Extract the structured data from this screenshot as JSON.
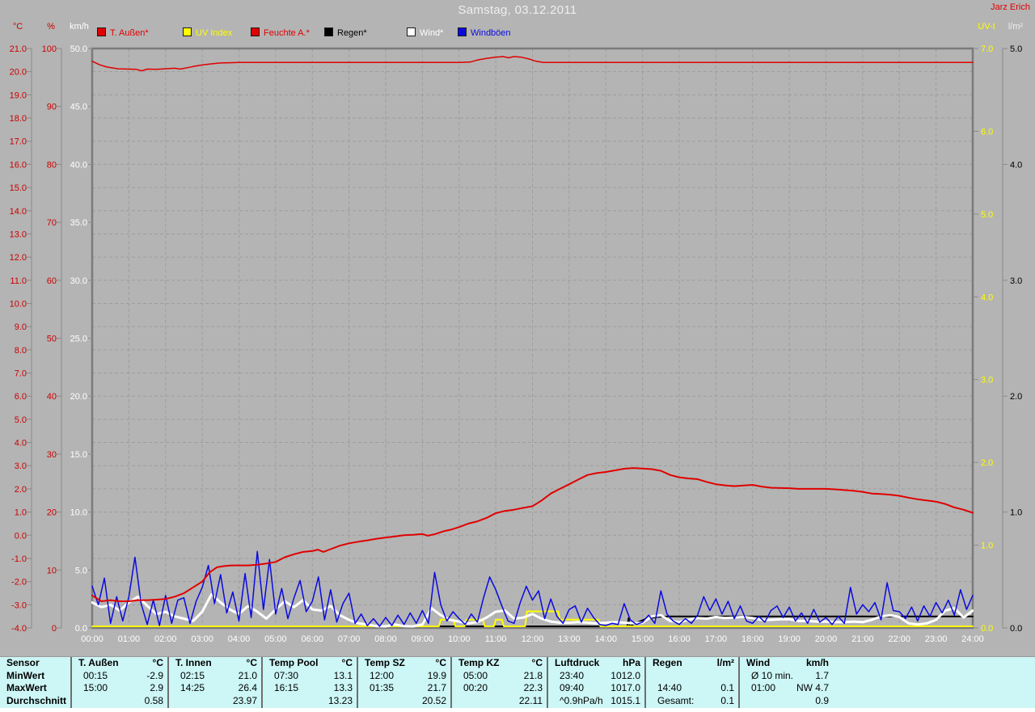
{
  "window": {
    "title": "Samstag, 03.12.2011",
    "credit": "Jarz Erich"
  },
  "legend": [
    {
      "label": "T. Außen*",
      "color": "#e00000"
    },
    {
      "label": "UV Index",
      "color": "#ffff00"
    },
    {
      "label": "Feuchte A.*",
      "color": "#e00000"
    },
    {
      "label": "Regen*",
      "color": "#000000"
    },
    {
      "label": "Wind*",
      "color": "#ffffff"
    },
    {
      "label": "Windböen",
      "color": "#0a0ae0"
    }
  ],
  "axes": {
    "left": [
      {
        "name": "°C",
        "color": "#cc0000",
        "min": -4,
        "max": 21,
        "step": 1,
        "decimals": 1
      },
      {
        "name": "%",
        "color": "#cc0000",
        "min": 0,
        "max": 100,
        "step": 10,
        "decimals": 0
      },
      {
        "name": "km/h",
        "color": "#ffffff",
        "min": 0,
        "max": 50,
        "step": 5,
        "decimals": 1
      }
    ],
    "right": [
      {
        "name": "UV-I",
        "color": "#ffff00",
        "min": 0,
        "max": 7,
        "step": 1,
        "decimals": 1
      },
      {
        "name": "l/m²",
        "color": "#000000",
        "header_color": "#eeeeee",
        "min": 0,
        "max": 5,
        "step": 1,
        "decimals": 1
      }
    ],
    "x_labels": [
      "00:00",
      "01:00",
      "02:00",
      "03:00",
      "04:00",
      "05:00",
      "06:00",
      "07:00",
      "08:00",
      "09:00",
      "10:00",
      "11:00",
      "12:00",
      "13:00",
      "14:00",
      "15:00",
      "16:00",
      "17:00",
      "18:00",
      "19:00",
      "20:00",
      "21:00",
      "22:00",
      "23:00",
      "24:00"
    ]
  },
  "chart_data": {
    "type": "line",
    "title": "Samstag, 03.12.2011",
    "x_unit": "hour",
    "x_range": [
      0,
      24
    ],
    "grid": "on",
    "series": [
      {
        "key": "regen",
        "name": "Regen",
        "axis": "l/m²",
        "unit": "l/m²",
        "color": "#000000",
        "width": 2,
        "points": [
          [
            0,
            0
          ],
          [
            14.58,
            0
          ],
          [
            14.62,
            0.085
          ],
          [
            14.65,
            0.01
          ],
          [
            14.8,
            0.04
          ],
          [
            15.1,
            0.08
          ],
          [
            15.4,
            0.095
          ],
          [
            15.7,
            0.1
          ],
          [
            24,
            0.1
          ]
        ]
      },
      {
        "key": "uv",
        "name": "UV Index",
        "axis": "UV-I",
        "unit": "UV-I",
        "color": "#ffff00",
        "width": 2,
        "points": [
          [
            0,
            0
          ],
          [
            9.45,
            0
          ],
          [
            9.5,
            0.1
          ],
          [
            9.85,
            0.1
          ],
          [
            9.9,
            0
          ],
          [
            10.15,
            0
          ],
          [
            10.2,
            0.1
          ],
          [
            10.65,
            0.1
          ],
          [
            10.7,
            0
          ],
          [
            10.95,
            0
          ],
          [
            11.0,
            0.1
          ],
          [
            11.17,
            0.1
          ],
          [
            11.22,
            0
          ],
          [
            11.8,
            0
          ],
          [
            11.85,
            0.2
          ],
          [
            12.7,
            0.2
          ],
          [
            12.75,
            0.1
          ],
          [
            13.8,
            0.1
          ],
          [
            13.85,
            0
          ],
          [
            24,
            0
          ]
        ]
      },
      {
        "key": "wind",
        "name": "Wind",
        "axis": "km/h",
        "unit": "km/h",
        "color": "#ffffff",
        "width": 3,
        "start": 0,
        "step_min": 15,
        "values": [
          2.2,
          1.8,
          2.0,
          1.5,
          2.2,
          2.7,
          1.9,
          1.2,
          1.4,
          1.0,
          0.8,
          0.6,
          1.4,
          2.9,
          2.2,
          1.6,
          1.2,
          1.9,
          1.4,
          0.8,
          1.6,
          2.3,
          1.8,
          2.4,
          1.6,
          1.5,
          1.9,
          1.1,
          0.7,
          0.4,
          0.3,
          0.15,
          0.1,
          0.3,
          0.15,
          0.1,
          0.3,
          1.7,
          1.1,
          0.7,
          0.55,
          0.4,
          0.5,
          0.9,
          1.4,
          1.5,
          0.8,
          0.9,
          1.2,
          0.8,
          0.55,
          0.45,
          0.45,
          0.5,
          0.45,
          0.4,
          0.45,
          0.5,
          0.45,
          0.4,
          0.45,
          1.0,
          1.1,
          0.6,
          0.5,
          0.7,
          0.85,
          0.8,
          0.95,
          0.85,
          0.9,
          0.95,
          0.85,
          0.7,
          0.7,
          0.75,
          0.75,
          0.6,
          0.6,
          0.55,
          0.55,
          0.5,
          0.5,
          0.55,
          0.5,
          0.7,
          1.0,
          1.1,
          0.95,
          0.4,
          0.3,
          0.4,
          0.7,
          1.5,
          1.7,
          0.9,
          1.5
        ]
      },
      {
        "key": "windboeen",
        "name": "Windböen",
        "axis": "km/h",
        "unit": "km/h",
        "color": "#0a0ae0",
        "width": 1.5,
        "start": 0,
        "step_min": 10,
        "values": [
          3.6,
          2.0,
          4.3,
          0.4,
          2.7,
          0.6,
          2.7,
          6.1,
          2.1,
          0.3,
          2.4,
          0.2,
          2.8,
          0.4,
          2.4,
          2.6,
          0.4,
          2.3,
          3.5,
          5.4,
          2.1,
          4.6,
          1.3,
          3.1,
          0.6,
          4.7,
          0.9,
          6.6,
          1.6,
          5.9,
          1.2,
          3.4,
          0.8,
          2.6,
          4.1,
          1.4,
          2.3,
          4.4,
          0.7,
          3.3,
          0.5,
          2.1,
          3.0,
          0.4,
          1.2,
          0.2,
          0.8,
          0.1,
          0.9,
          0.2,
          1.1,
          0.3,
          1.3,
          0.4,
          1.5,
          0.4,
          4.8,
          2.0,
          0.6,
          1.4,
          0.8,
          0.3,
          1.2,
          0.5,
          2.6,
          4.4,
          3.3,
          1.9,
          0.6,
          0.4,
          2.2,
          3.6,
          2.4,
          3.2,
          0.8,
          2.5,
          1.0,
          0.4,
          1.6,
          1.9,
          0.5,
          1.7,
          0.9,
          0.3,
          0.2,
          0.4,
          0.3,
          2.1,
          0.7,
          0.3,
          0.5,
          1.1,
          0.4,
          3.2,
          1.2,
          0.6,
          0.3,
          0.8,
          0.4,
          1.1,
          2.7,
          1.5,
          2.5,
          1.2,
          2.3,
          0.8,
          1.9,
          0.6,
          0.4,
          1.0,
          0.5,
          1.5,
          1.9,
          0.9,
          1.8,
          0.6,
          1.3,
          0.4,
          1.6,
          0.5,
          0.9,
          0.3,
          1.0,
          0.4,
          3.5,
          1.2,
          2.0,
          1.4,
          2.2,
          0.7,
          3.9,
          1.5,
          1.4,
          0.8,
          1.8,
          0.6,
          1.9,
          1.0,
          2.2,
          1.3,
          2.4,
          1.1,
          3.3,
          1.6,
          2.8
        ]
      },
      {
        "key": "feuchte",
        "name": "Feuchte A.",
        "axis": "%",
        "unit": "%",
        "color": "#e00000",
        "width": 1.5,
        "points": [
          [
            0,
            97.8
          ],
          [
            0.2,
            97.2
          ],
          [
            0.4,
            96.8
          ],
          [
            0.7,
            96.5
          ],
          [
            1,
            96.45
          ],
          [
            1.2,
            96.4
          ],
          [
            1.35,
            96.15
          ],
          [
            1.5,
            96.45
          ],
          [
            1.75,
            96.4
          ],
          [
            2,
            96.5
          ],
          [
            2.25,
            96.6
          ],
          [
            2.4,
            96.45
          ],
          [
            2.6,
            96.7
          ],
          [
            2.8,
            96.95
          ],
          [
            3,
            97.15
          ],
          [
            3.25,
            97.35
          ],
          [
            3.5,
            97.5
          ],
          [
            3.75,
            97.55
          ],
          [
            4,
            97.6
          ],
          [
            10,
            97.6
          ],
          [
            10.3,
            97.65
          ],
          [
            10.5,
            98.0
          ],
          [
            10.75,
            98.3
          ],
          [
            11,
            98.5
          ],
          [
            11.2,
            98.6
          ],
          [
            11.35,
            98.4
          ],
          [
            11.5,
            98.6
          ],
          [
            11.7,
            98.5
          ],
          [
            11.9,
            98.2
          ],
          [
            12.1,
            97.8
          ],
          [
            12.3,
            97.6
          ],
          [
            24,
            97.6
          ]
        ]
      },
      {
        "key": "temp_aussen",
        "name": "T. Außen",
        "axis": "°C",
        "unit": "°C",
        "color": "#e00000",
        "width": 2,
        "points": [
          [
            0,
            -2.6
          ],
          [
            0.25,
            -2.85
          ],
          [
            0.5,
            -2.8
          ],
          [
            0.75,
            -2.85
          ],
          [
            1,
            -2.85
          ],
          [
            1.25,
            -2.8
          ],
          [
            1.5,
            -2.8
          ],
          [
            1.75,
            -2.78
          ],
          [
            2,
            -2.75
          ],
          [
            2.25,
            -2.65
          ],
          [
            2.5,
            -2.5
          ],
          [
            2.75,
            -2.25
          ],
          [
            3,
            -2.0
          ],
          [
            3.2,
            -1.6
          ],
          [
            3.4,
            -1.38
          ],
          [
            3.6,
            -1.33
          ],
          [
            3.8,
            -1.3
          ],
          [
            4,
            -1.3
          ],
          [
            4.25,
            -1.3
          ],
          [
            4.5,
            -1.27
          ],
          [
            4.75,
            -1.22
          ],
          [
            5,
            -1.15
          ],
          [
            5.25,
            -0.95
          ],
          [
            5.5,
            -0.82
          ],
          [
            5.75,
            -0.72
          ],
          [
            6,
            -0.68
          ],
          [
            6.15,
            -0.62
          ],
          [
            6.3,
            -0.72
          ],
          [
            6.5,
            -0.6
          ],
          [
            6.75,
            -0.45
          ],
          [
            7,
            -0.35
          ],
          [
            7.25,
            -0.28
          ],
          [
            7.5,
            -0.22
          ],
          [
            7.75,
            -0.15
          ],
          [
            8,
            -0.1
          ],
          [
            8.25,
            -0.05
          ],
          [
            8.5,
            0.0
          ],
          [
            8.75,
            0.02
          ],
          [
            9,
            0.05
          ],
          [
            9.15,
            -0.02
          ],
          [
            9.35,
            0.05
          ],
          [
            9.6,
            0.18
          ],
          [
            9.8,
            0.25
          ],
          [
            10,
            0.35
          ],
          [
            10.25,
            0.5
          ],
          [
            10.5,
            0.6
          ],
          [
            10.75,
            0.75
          ],
          [
            11,
            0.95
          ],
          [
            11.25,
            1.05
          ],
          [
            11.5,
            1.1
          ],
          [
            11.75,
            1.18
          ],
          [
            12,
            1.25
          ],
          [
            12.25,
            1.5
          ],
          [
            12.5,
            1.8
          ],
          [
            12.75,
            2.0
          ],
          [
            13,
            2.2
          ],
          [
            13.25,
            2.4
          ],
          [
            13.5,
            2.6
          ],
          [
            13.75,
            2.68
          ],
          [
            14,
            2.73
          ],
          [
            14.25,
            2.8
          ],
          [
            14.5,
            2.87
          ],
          [
            14.75,
            2.9
          ],
          [
            15,
            2.88
          ],
          [
            15.25,
            2.85
          ],
          [
            15.5,
            2.78
          ],
          [
            15.75,
            2.6
          ],
          [
            16,
            2.5
          ],
          [
            16.25,
            2.45
          ],
          [
            16.5,
            2.42
          ],
          [
            16.75,
            2.3
          ],
          [
            17,
            2.2
          ],
          [
            17.25,
            2.15
          ],
          [
            17.5,
            2.12
          ],
          [
            18,
            2.17
          ],
          [
            18.25,
            2.1
          ],
          [
            18.5,
            2.05
          ],
          [
            19,
            2.03
          ],
          [
            19.25,
            2.0
          ],
          [
            19.5,
            2.0
          ],
          [
            20,
            2.0
          ],
          [
            20.25,
            1.98
          ],
          [
            20.5,
            1.95
          ],
          [
            20.75,
            1.92
          ],
          [
            21,
            1.87
          ],
          [
            21.25,
            1.8
          ],
          [
            21.5,
            1.78
          ],
          [
            21.75,
            1.75
          ],
          [
            22,
            1.7
          ],
          [
            22.25,
            1.62
          ],
          [
            22.5,
            1.55
          ],
          [
            22.75,
            1.5
          ],
          [
            23,
            1.45
          ],
          [
            23.25,
            1.35
          ],
          [
            23.5,
            1.2
          ],
          [
            23.75,
            1.1
          ],
          [
            24,
            0.97
          ]
        ]
      }
    ]
  },
  "table": {
    "row_labels": [
      "Sensor",
      "MinWert",
      "MaxWert",
      "Durchschnitt"
    ],
    "columns": [
      {
        "name": "T. Außen",
        "unit": "°C",
        "min": [
          "00:15",
          "-2.9"
        ],
        "max": [
          "15:00",
          "2.9"
        ],
        "avg": [
          "",
          "0.58"
        ]
      },
      {
        "name": "T. Innen",
        "unit": "°C",
        "min": [
          "02:15",
          "21.0"
        ],
        "max": [
          "14:25",
          "26.4"
        ],
        "avg": [
          "",
          "23.97"
        ]
      },
      {
        "name": "Temp Pool",
        "unit": "°C",
        "min": [
          "07:30",
          "13.1"
        ],
        "max": [
          "16:15",
          "13.3"
        ],
        "avg": [
          "",
          "13.23"
        ]
      },
      {
        "name": "Temp SZ",
        "unit": "°C",
        "min": [
          "12:00",
          "19.9"
        ],
        "max": [
          "01:35",
          "21.7"
        ],
        "avg": [
          "",
          "20.52"
        ]
      },
      {
        "name": "Temp KZ",
        "unit": "°C",
        "min": [
          "05:00",
          "21.8"
        ],
        "max": [
          "00:20",
          "22.3"
        ],
        "avg": [
          "",
          "22.11"
        ]
      },
      {
        "name": "Luftdruck",
        "unit": "hPa",
        "min": [
          "23:40",
          "1012.0"
        ],
        "max": [
          "09:40",
          "1017.0"
        ],
        "avg": [
          "^0.9hPa/h",
          "1015.1"
        ]
      },
      {
        "name": "Regen",
        "unit": "l/m²",
        "min": [
          "",
          ""
        ],
        "max": [
          "14:40",
          "0.1"
        ],
        "avg": [
          "Gesamt:",
          "0.1"
        ]
      },
      {
        "name": "Wind",
        "unit": "km/h",
        "min": [
          "Ø 10 min.",
          "1.7"
        ],
        "max": [
          "01:00",
          "NW 4.7"
        ],
        "avg": [
          "",
          "0.9"
        ]
      }
    ]
  }
}
